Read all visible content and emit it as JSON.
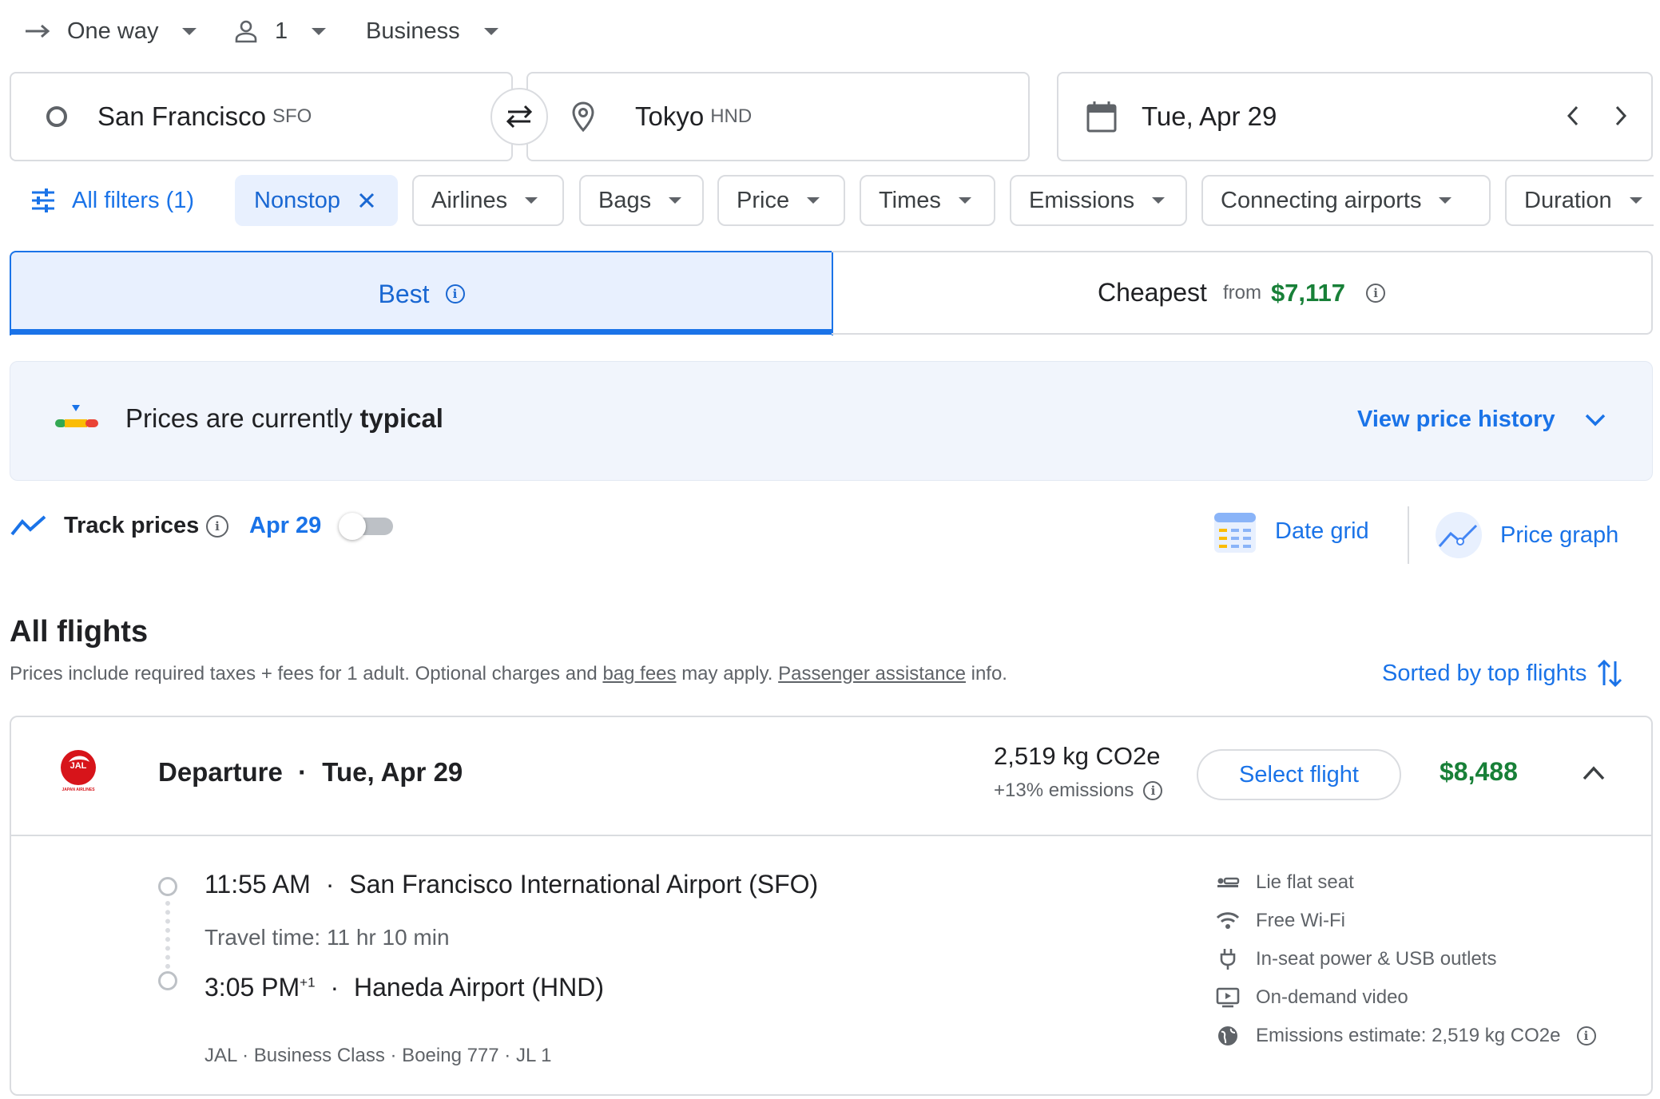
{
  "top_bar": {
    "trip_type": "One way",
    "passengers": "1",
    "cabin_class": "Business"
  },
  "search": {
    "origin_city": "San Francisco",
    "origin_code": "SFO",
    "destination_city": "Tokyo",
    "destination_code": "HND",
    "date": "Tue, Apr 29"
  },
  "filters": {
    "all_filters": "All filters (1)",
    "nonstop": "Nonstop",
    "chips": [
      "Airlines",
      "Bags",
      "Price",
      "Times",
      "Emissions",
      "Connecting airports",
      "Duration"
    ]
  },
  "tabs": {
    "best": "Best",
    "cheapest": "Cheapest",
    "cheapest_from": "from",
    "cheapest_price": "$7,117"
  },
  "price_insight": {
    "text_prefix": "Prices are currently",
    "text_level": "typical",
    "view_history": "View price history"
  },
  "track": {
    "label": "Track prices",
    "date": "Apr 29",
    "enabled": false,
    "date_grid": "Date grid",
    "price_graph": "Price graph"
  },
  "results": {
    "heading": "All flights",
    "note_part1": "Prices include required taxes + fees for 1 adult. Optional charges and",
    "note_link1": "bag fees",
    "note_part2": "may apply.",
    "note_link2": "Passenger assistance",
    "note_part3": "info.",
    "sort_label": "Sorted by top flights"
  },
  "flight": {
    "airline_logo_text": "JAL",
    "airline_logo_subtext": "JAPAN AIRLINES",
    "departure_label": "Departure",
    "sep": "·",
    "departure_date": "Tue, Apr 29",
    "emissions": "2,519 kg CO2e",
    "emissions_delta": "+13% emissions",
    "select_label": "Select flight",
    "price": "$8,488",
    "depart_time": "11:55 AM",
    "depart_airport": "San Francisco International Airport (SFO)",
    "travel_time": "Travel time: 11 hr 10 min",
    "arrive_time": "3:05 PM",
    "arrive_day_offset": "+1",
    "arrive_airport": "Haneda Airport (HND)",
    "details": "JAL · Business Class · Boeing 777 · JL 1",
    "amenities": [
      {
        "icon": "lie-flat-seat-icon",
        "label": "Lie flat seat"
      },
      {
        "icon": "wifi-icon",
        "label": "Free Wi-Fi"
      },
      {
        "icon": "power-plug-icon",
        "label": "In-seat power & USB outlets"
      },
      {
        "icon": "video-icon",
        "label": "On-demand video"
      },
      {
        "icon": "globe-icon",
        "label": "Emissions estimate: 2,519 kg CO2e"
      }
    ]
  },
  "colors": {
    "accent_blue": "#1a73e8",
    "price_green": "#188038",
    "tab_bg": "#e8f0fe",
    "banner_bg": "#f1f5fc",
    "border": "#dadce0"
  }
}
